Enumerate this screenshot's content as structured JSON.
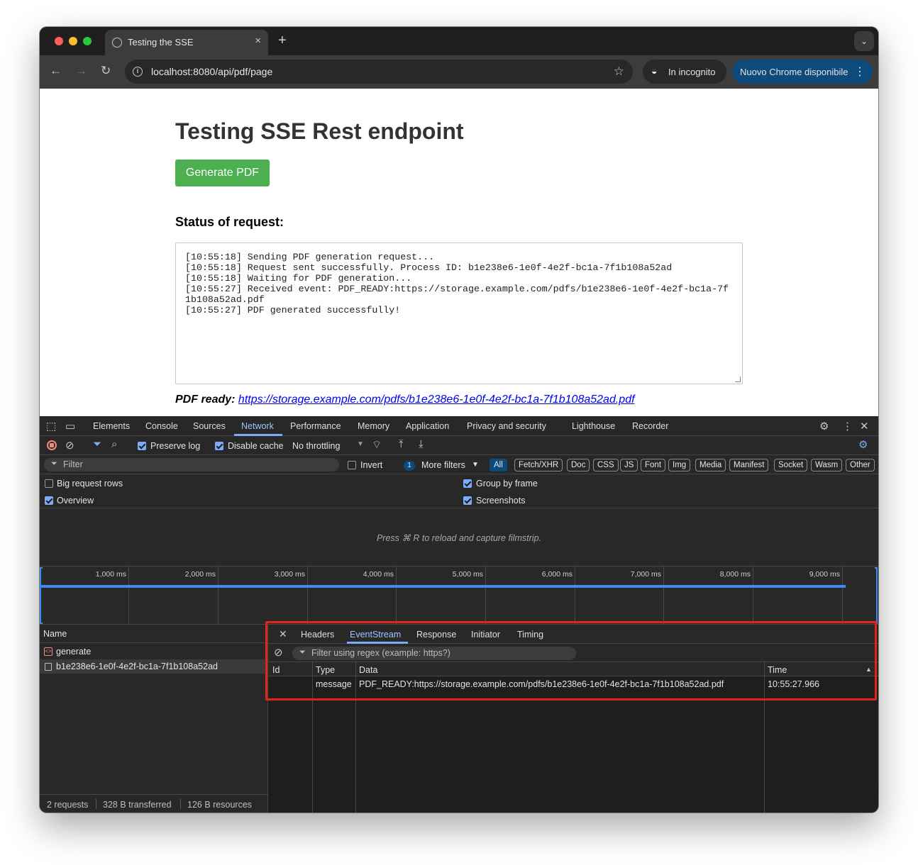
{
  "browser": {
    "tab_title": "Testing the SSE",
    "url": "localhost:8080/api/pdf/page",
    "incognito_label": "In incognito",
    "update_label": "Nuovo Chrome disponibile",
    "tab_close": "×",
    "new_tab": "+"
  },
  "page": {
    "heading": "Testing SSE Rest endpoint",
    "generate_button": "Generate PDF",
    "status_heading": "Status of request:",
    "log": "[10:55:18] Sending PDF generation request...\n[10:55:18] Request sent successfully. Process ID: b1e238e6-1e0f-4e2f-bc1a-7f1b108a52ad\n[10:55:18] Waiting for PDF generation...\n[10:55:27] Received event: PDF_READY:https://storage.example.com/pdfs/b1e238e6-1e0f-4e2f-bc1a-7f1b108a52ad.pdf\n[10:55:27] PDF generated successfully!",
    "pdf_ready_label": "PDF ready:",
    "pdf_link": "https://storage.example.com/pdfs/b1e238e6-1e0f-4e2f-bc1a-7f1b108a52ad.pdf"
  },
  "devtools": {
    "tabs": [
      "Elements",
      "Console",
      "Sources",
      "Network",
      "Performance",
      "Memory",
      "Application",
      "Privacy and security",
      "Lighthouse",
      "Recorder"
    ],
    "active_tab": "Network",
    "preserve_log": "Preserve log",
    "disable_cache": "Disable cache",
    "throttling": "No throttling",
    "filter_placeholder": "Filter",
    "invert": "Invert",
    "more_filters_count": "1",
    "more_filters": "More filters",
    "type_filters": [
      "All",
      "Fetch/XHR",
      "Doc",
      "CSS",
      "JS",
      "Font",
      "Img",
      "Media",
      "Manifest",
      "Socket",
      "Wasm",
      "Other"
    ],
    "big_request_rows": "Big request rows",
    "group_by_frame": "Group by frame",
    "overview": "Overview",
    "screenshots": "Screenshots",
    "filmstrip_hint": "Press ⌘ R to reload and capture filmstrip.",
    "timeline_ticks": [
      "1,000 ms",
      "2,000 ms",
      "3,000 ms",
      "4,000 ms",
      "5,000 ms",
      "6,000 ms",
      "7,000 ms",
      "8,000 ms",
      "9,000 ms"
    ],
    "name_header": "Name",
    "requests": [
      "generate",
      "b1e238e6-1e0f-4e2f-bc1a-7f1b108a52ad"
    ],
    "footer": {
      "requests": "2 requests",
      "transferred": "328 B transferred",
      "resources": "126 B resources"
    },
    "detail_tabs": [
      "Headers",
      "EventStream",
      "Response",
      "Initiator",
      "Timing"
    ],
    "detail_active": "EventStream",
    "detail_filter_placeholder": "Filter using regex (example: https?)",
    "columns": [
      "Id",
      "Type",
      "Data",
      "Time"
    ],
    "events": [
      {
        "id": "",
        "type": "message",
        "data": "PDF_READY:https://storage.example.com/pdfs/b1e238e6-1e0f-4e2f-bc1a-7f1b108a52ad.pdf",
        "time": "10:55:27.966"
      }
    ]
  },
  "colors": {
    "accent": "#7cacf8",
    "button_green": "#4caf50",
    "highlight_red": "#e0261c"
  }
}
